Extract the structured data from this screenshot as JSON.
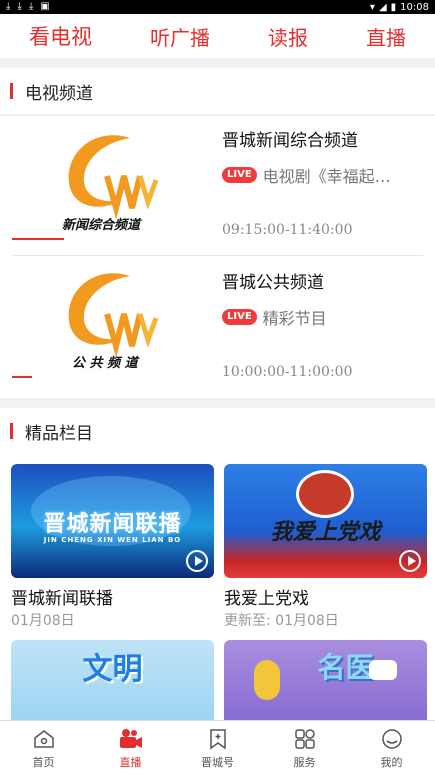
{
  "status_bar": {
    "left_icons": [
      "download-icon",
      "download-icon",
      "download-icon",
      "android-icon"
    ],
    "time": "10:08"
  },
  "top_tabs": [
    {
      "label": "看电视",
      "active": true
    },
    {
      "label": "听广播"
    },
    {
      "label": "读报"
    },
    {
      "label": "直播"
    }
  ],
  "tv_section": {
    "title": "电视频道",
    "channels": [
      {
        "logo_text": "新闻综合频道",
        "name": "晋城新闻综合频道",
        "live_badge": "LIVE",
        "now_playing": "电视剧《幸福起…",
        "time_range": "09:15:00-11:40:00"
      },
      {
        "logo_text": "公 共 频 道",
        "name": "晋城公共频道",
        "live_badge": "LIVE",
        "now_playing": "精彩节目",
        "time_range": "10:00:00-11:00:00"
      }
    ]
  },
  "featured_section": {
    "title": "精品栏目",
    "cards": [
      {
        "thumb_text": "晋城新闻联播",
        "thumb_subtext": "JIN CHENG XIN WEN LIAN BO",
        "title": "晋城新闻联播",
        "date": "01月08日"
      },
      {
        "thumb_text": "我爱上党戏",
        "title": "我爱上党戏",
        "date": "更新至:   01月08日"
      },
      {
        "thumb_text": "文明",
        "title": "",
        "date": ""
      },
      {
        "thumb_text": "名医",
        "title": "",
        "date": ""
      }
    ]
  },
  "bottom_nav": [
    {
      "label": "首页",
      "icon": "home-icon"
    },
    {
      "label": "直播",
      "icon": "video-camera-icon",
      "active": true
    },
    {
      "label": "晋城号",
      "icon": "bookmark-icon"
    },
    {
      "label": "服务",
      "icon": "grid-icon"
    },
    {
      "label": "我的",
      "icon": "profile-icon"
    }
  ],
  "colors": {
    "accent": "#e52f2f",
    "logo_orange": "#f29a1f"
  }
}
